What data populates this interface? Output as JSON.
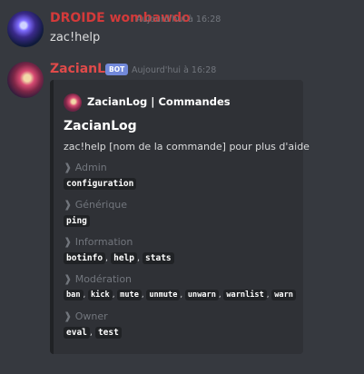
{
  "messages": {
    "user": {
      "author": "DROIDE wombawdo",
      "timestamp": "Aujourd'hui à 16:28",
      "content": "zac!help"
    },
    "bot": {
      "author": "ZacianLog",
      "tag": "BOT",
      "timestamp": "Aujourd'hui à 16:28"
    }
  },
  "embed": {
    "author": "ZacianLog | Commandes",
    "title": "ZacianLog",
    "description": "zac!help [nom de la commande] pour plus d'aide",
    "fields": [
      {
        "name": "❱ Admin",
        "values": [
          "configuration"
        ]
      },
      {
        "name": "❱ Générique",
        "values": [
          "ping"
        ]
      },
      {
        "name": "❱ Information",
        "values": [
          "botinfo",
          "help",
          "stats"
        ]
      },
      {
        "name": "❱ Modération",
        "values": [
          "ban",
          "kick",
          "mute",
          "unmute",
          "unwarn",
          "warnlist",
          "warn"
        ]
      },
      {
        "name": "❱ Owner",
        "values": [
          "eval",
          "test"
        ]
      }
    ]
  },
  "colors": {
    "background": "#36393f",
    "embed_background": "#2f3136",
    "bot_tag": "#7289da",
    "username_red": "#e04a4a"
  },
  "icons": {
    "user_avatar": "user-avatar-icon",
    "bot_avatar": "bot-avatar-icon",
    "embed_author_icon": "embed-author-icon"
  }
}
